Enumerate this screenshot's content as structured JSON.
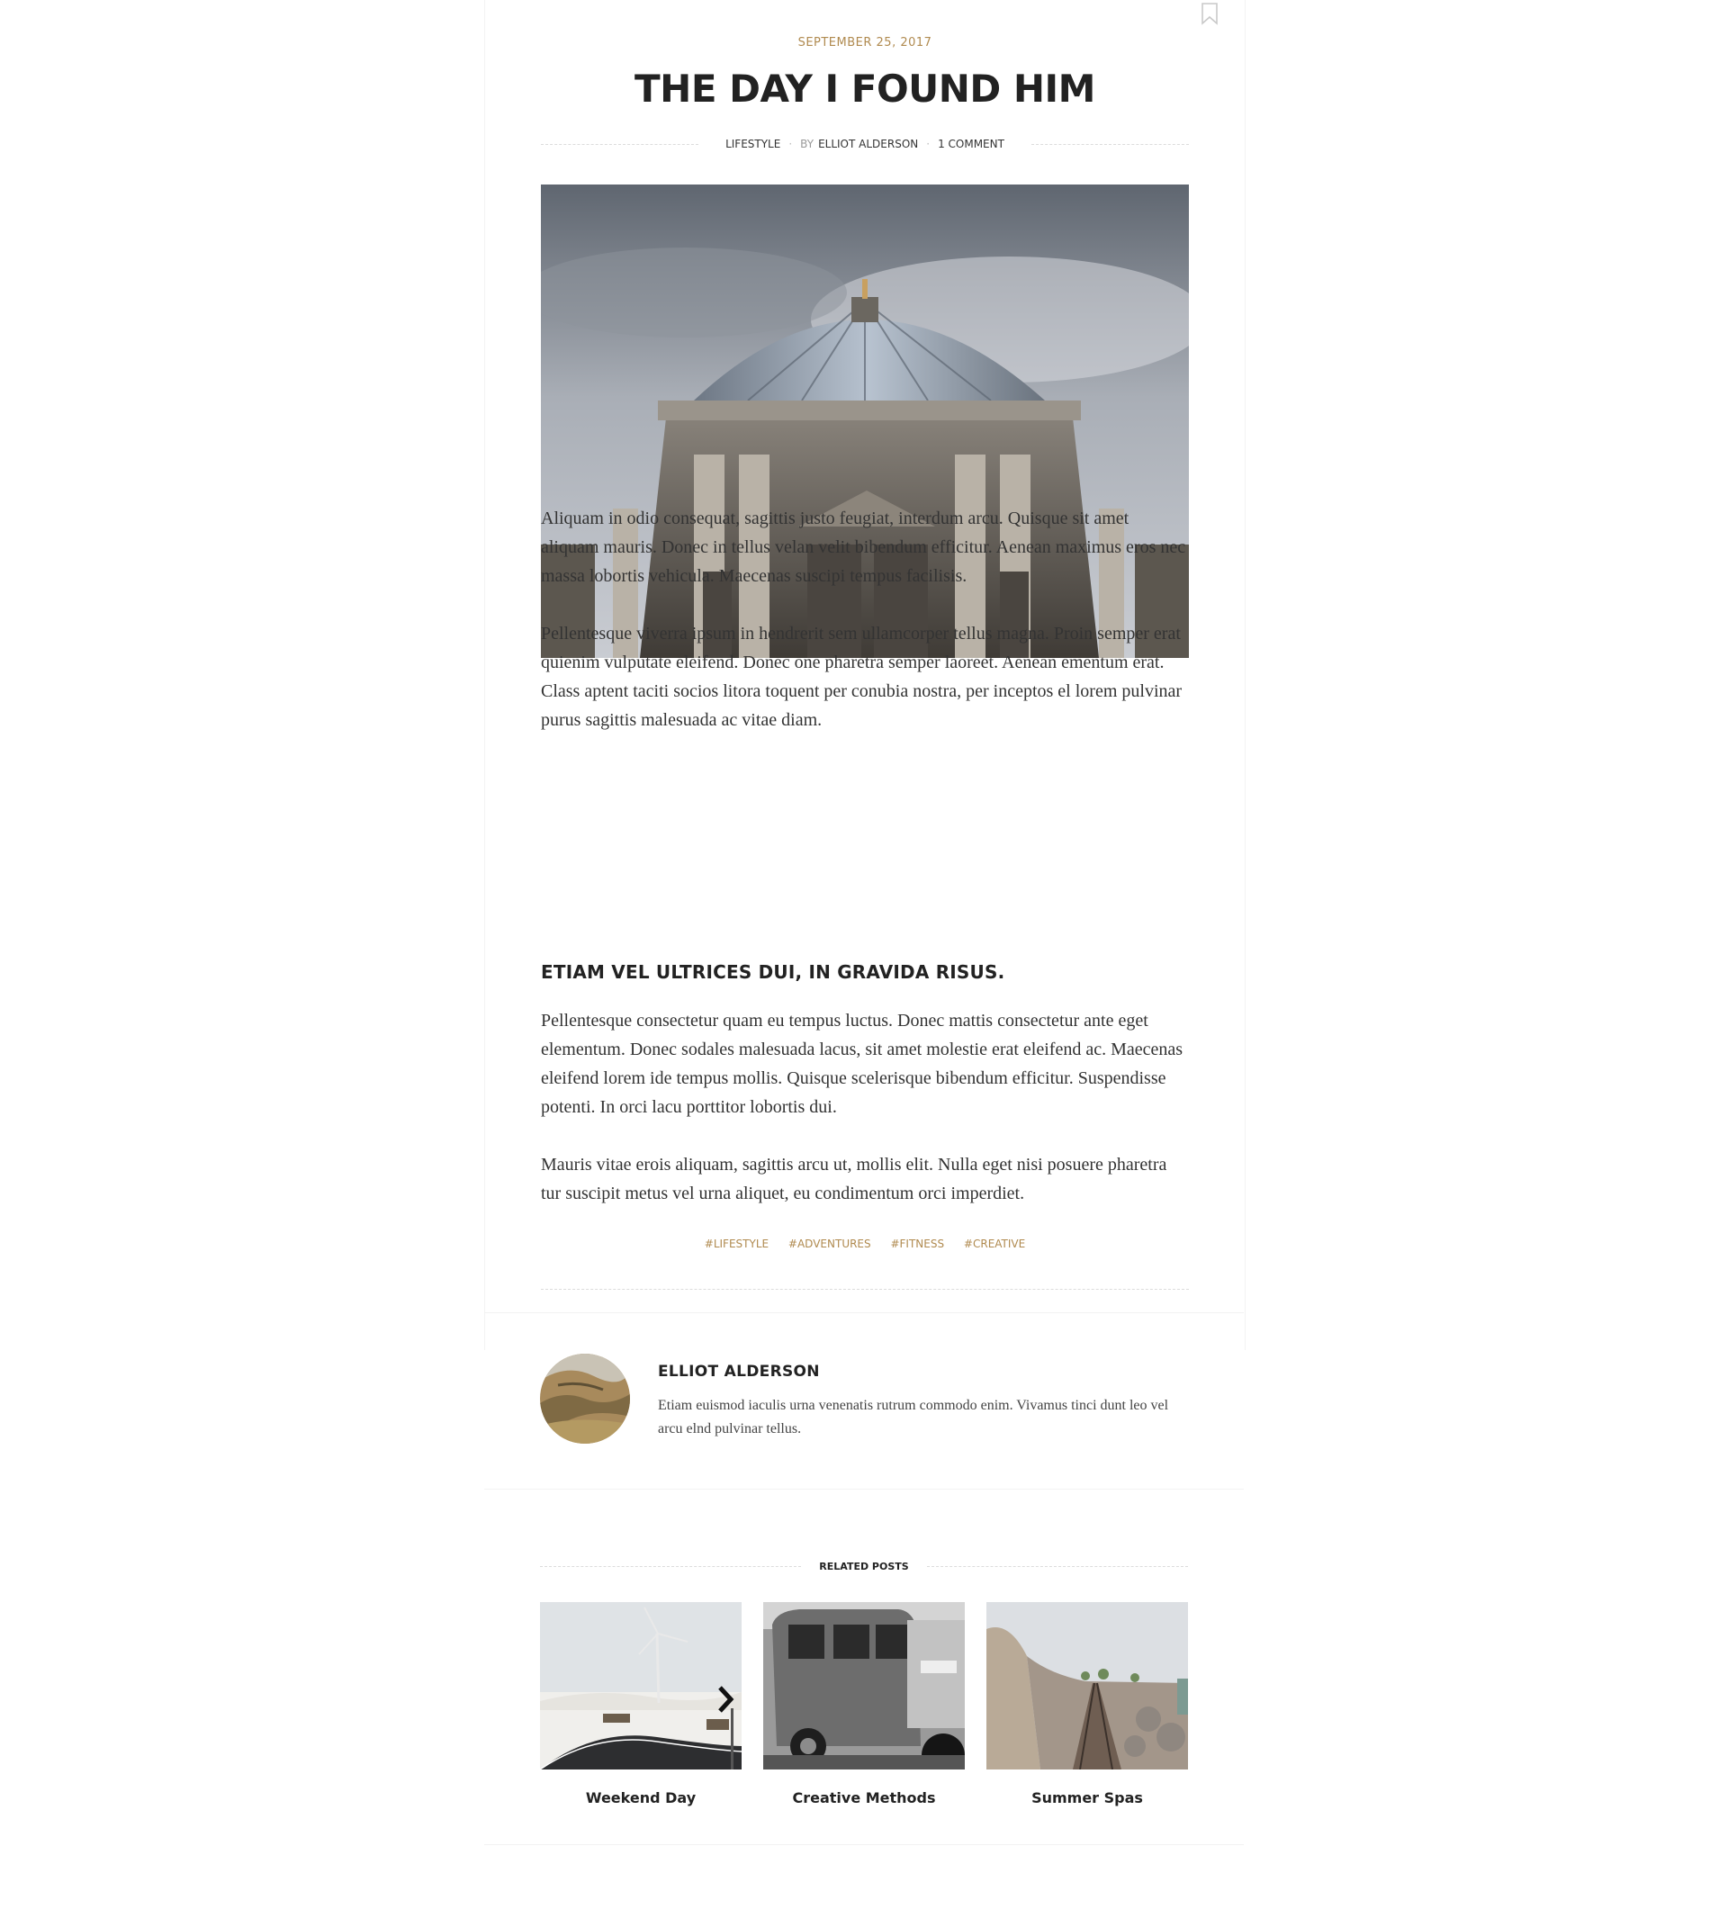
{
  "post": {
    "date": "SEPTEMBER 25, 2017",
    "title": "THE DAY I FOUND HIM",
    "category": "LIFESTYLE",
    "by_label": "BY",
    "author": "ELLIOT ALDERSON",
    "comments": "1 COMMENT",
    "paragraphs": [
      "Aliquam in odio consequat, sagittis justo feugiat, interdum arcu. Quisque sit amet aliquam mauris. Donec in tellus velan velit bibendum efficitur. Aenean maximus eros nec massa lobortis vehicula. Maecenas suscipi tempus facilisis.",
      "Pellentesque viverra ipsum in hendrerit sem ullamcorper tellus magna. Proin semper erat quienim vulputate eleifend. Donec one pharetra semper laoreet. Aenean ementum erat. Class aptent taciti socios litora toquent per conubia nostra, per inceptos el lorem pulvinar purus sagittis malesuada ac vitae diam.",
      "Pellentesque consectetur quam eu tempus luctus. Donec mattis consectetur ante eget elementum. Donec sodales malesuada lacus, sit amet molestie erat eleifend ac. Maecenas eleifend lorem ide tempus mollis. Quisque scelerisque bibendum efficitur. Suspendisse potenti. In orci lacu porttitor lobortis dui.",
      "Mauris vitae erois aliquam, sagittis arcu ut, mollis elit. Nulla eget nisi posuere pharetra tur suscipit metus vel urna aliquet, eu condimentum orci imperdiet."
    ],
    "subheading": "ETIAM VEL ULTRICES DUI, IN GRAVIDA RISUS.",
    "tags": [
      "#LIFESTYLE",
      "#ADVENTURES",
      "#FITNESS",
      "#CREATIVE"
    ]
  },
  "author_box": {
    "name": "ELLIOT ALDERSON",
    "bio": "Etiam euismod iaculis urna venenatis rutrum commodo enim. Vivamus tinci dunt leo vel arcu elnd pulvinar tellus."
  },
  "related": {
    "heading": "RELATED POSTS",
    "items": [
      {
        "title": "Weekend Day"
      },
      {
        "title": "Creative Methods"
      },
      {
        "title": "Summer Spas"
      }
    ]
  },
  "icons": {
    "bookmark": "bookmark-icon"
  },
  "colors": {
    "accent": "#b08a4f",
    "heading": "#222222",
    "body": "#333333"
  }
}
